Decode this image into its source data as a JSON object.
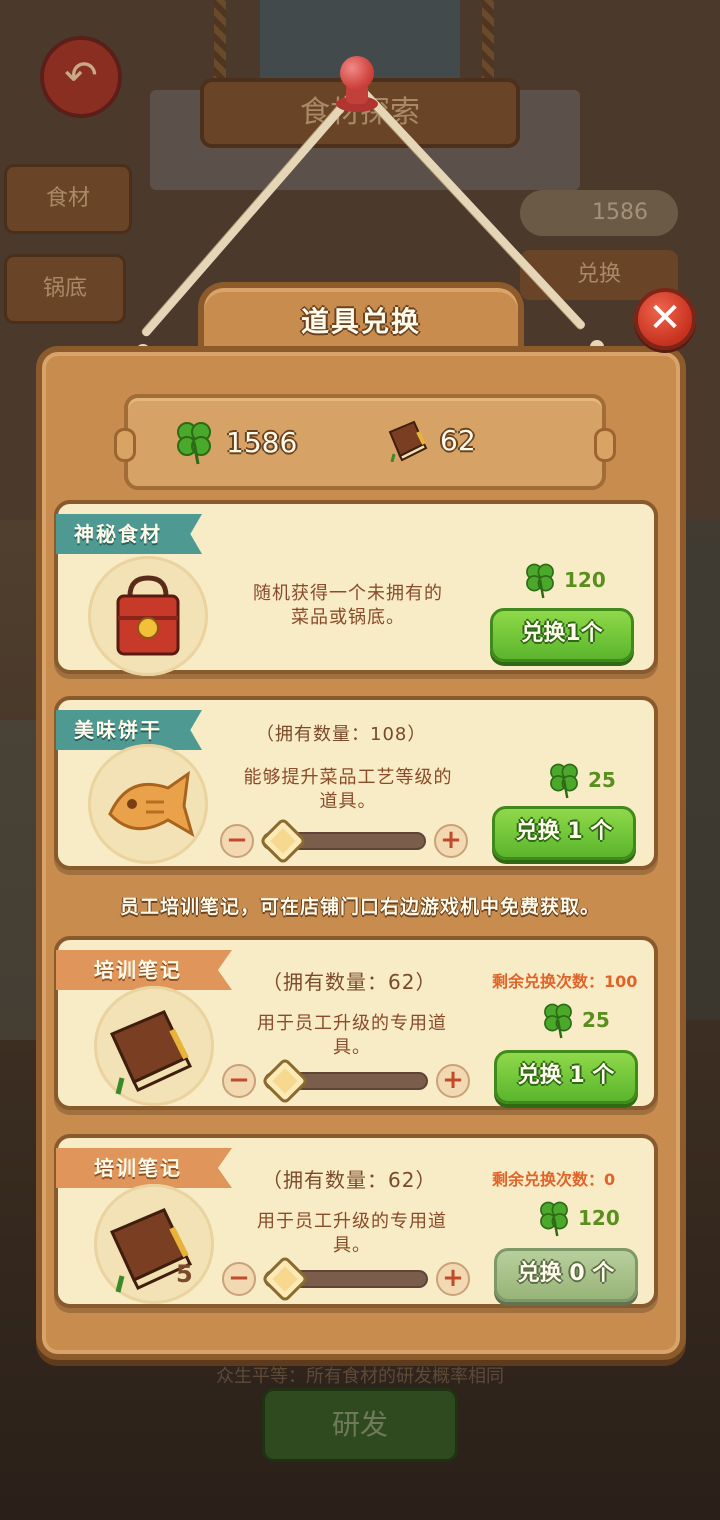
{
  "background": {
    "back_glyph": "↶",
    "title": "食材探索",
    "side_tabs": [
      "食材",
      "锅底"
    ],
    "clover_count": "1586",
    "exchange_label": "兑换",
    "hint_text": "众生平等：所有食材的研发概率相同",
    "develop_label": "研发"
  },
  "dialog": {
    "title": "道具兑换",
    "close_glyph": "✕",
    "currency": {
      "clover_icon": "clover-icon",
      "clover_value": "1586",
      "notebook_icon": "notebook-icon",
      "notebook_value": "62"
    },
    "info_line": "员工培训笔记，可在店铺门口右边游戏机中免费获取。",
    "items": [
      {
        "name": "神秘食材",
        "owned": "",
        "remaining": "",
        "description_line1": "随机获得一个未拥有的",
        "description_line2": "菜品或锅底。",
        "cost": "120",
        "button": "兑换1个",
        "enabled": true,
        "quantity_badge": "",
        "icon": "lunchbox-icon"
      },
      {
        "name": "美味饼干",
        "owned": "（拥有数量：108）",
        "remaining": "",
        "description_line1": "能够提升菜品工艺等级的",
        "description_line2": "道具。",
        "cost": "25",
        "button": "兑换 1 个",
        "enabled": true,
        "quantity_badge": "",
        "icon": "fish-cookie-icon"
      },
      {
        "name": "培训笔记",
        "owned": "（拥有数量：62）",
        "remaining": "剩余兑换次数：100",
        "description_line1": "用于员工升级的专用道",
        "description_line2": "具。",
        "cost": "25",
        "button": "兑换 1 个",
        "enabled": true,
        "quantity_badge": "",
        "icon": "notebook-icon"
      },
      {
        "name": "培训笔记",
        "owned": "（拥有数量：62）",
        "remaining": "剩余兑换次数：0",
        "description_line1": "用于员工升级的专用道",
        "description_line2": "具。",
        "cost": "120",
        "button": "兑换 0 个",
        "enabled": false,
        "quantity_badge": "5",
        "icon": "notebook-icon"
      }
    ],
    "stepper": {
      "minus": "−",
      "plus": "+"
    }
  },
  "colors": {
    "panel_wood": "#c88c4e",
    "card_bg": "#f8ecc6",
    "button_green": "#5bb52c",
    "clover_green": "#4aa82a",
    "ribbon_teal": "#4e9a93",
    "ribbon_orange": "#e0955a",
    "close_red": "#c7321f"
  }
}
